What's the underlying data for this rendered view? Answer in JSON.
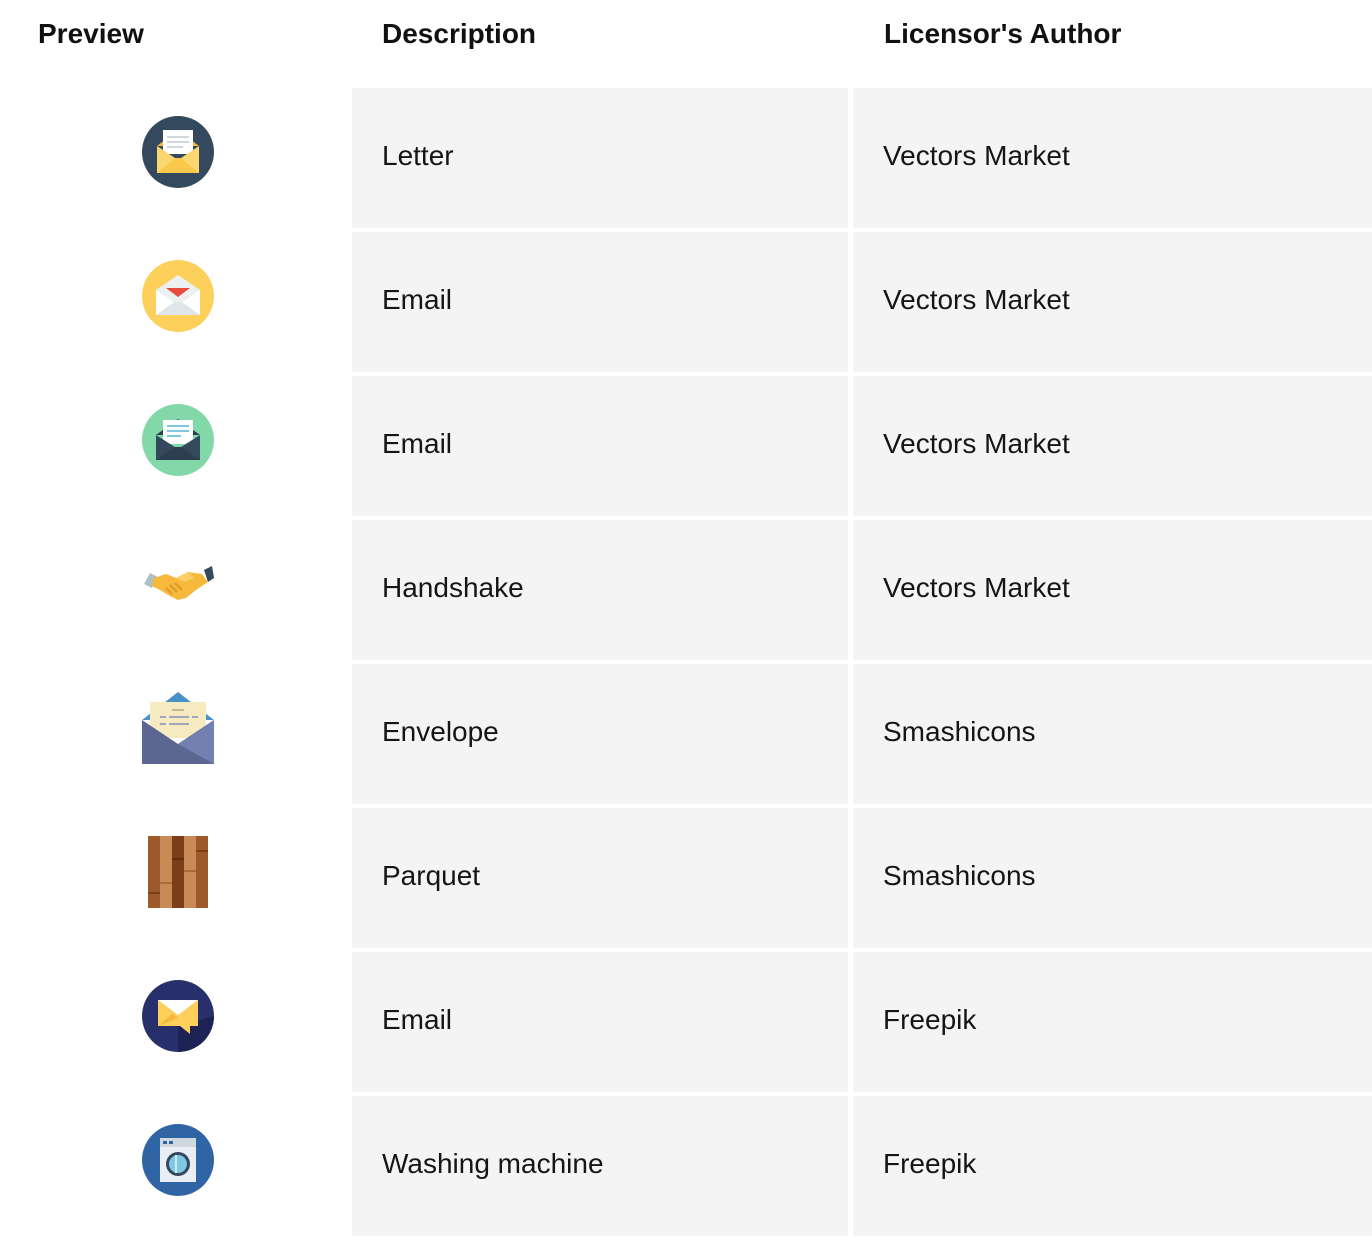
{
  "headers": {
    "preview": "Preview",
    "description": "Description",
    "author": "Licensor's Author"
  },
  "rows": [
    {
      "icon": "letter-icon",
      "description": "Letter",
      "author": "Vectors Market"
    },
    {
      "icon": "email-icon",
      "description": "Email",
      "author": "Vectors Market"
    },
    {
      "icon": "email-icon",
      "description": "Email",
      "author": "Vectors Market"
    },
    {
      "icon": "handshake-icon",
      "description": "Handshake",
      "author": "Vectors Market"
    },
    {
      "icon": "envelope-icon",
      "description": "Envelope",
      "author": "Smashicons"
    },
    {
      "icon": "parquet-icon",
      "description": "Parquet",
      "author": "Smashicons"
    },
    {
      "icon": "email-icon",
      "description": "Email",
      "author": "Freepik"
    },
    {
      "icon": "washing-machine-icon",
      "description": "Washing machine",
      "author": "Freepik"
    }
  ],
  "colors": {
    "cell_background": "#f4f4f4",
    "text": "#151515"
  }
}
